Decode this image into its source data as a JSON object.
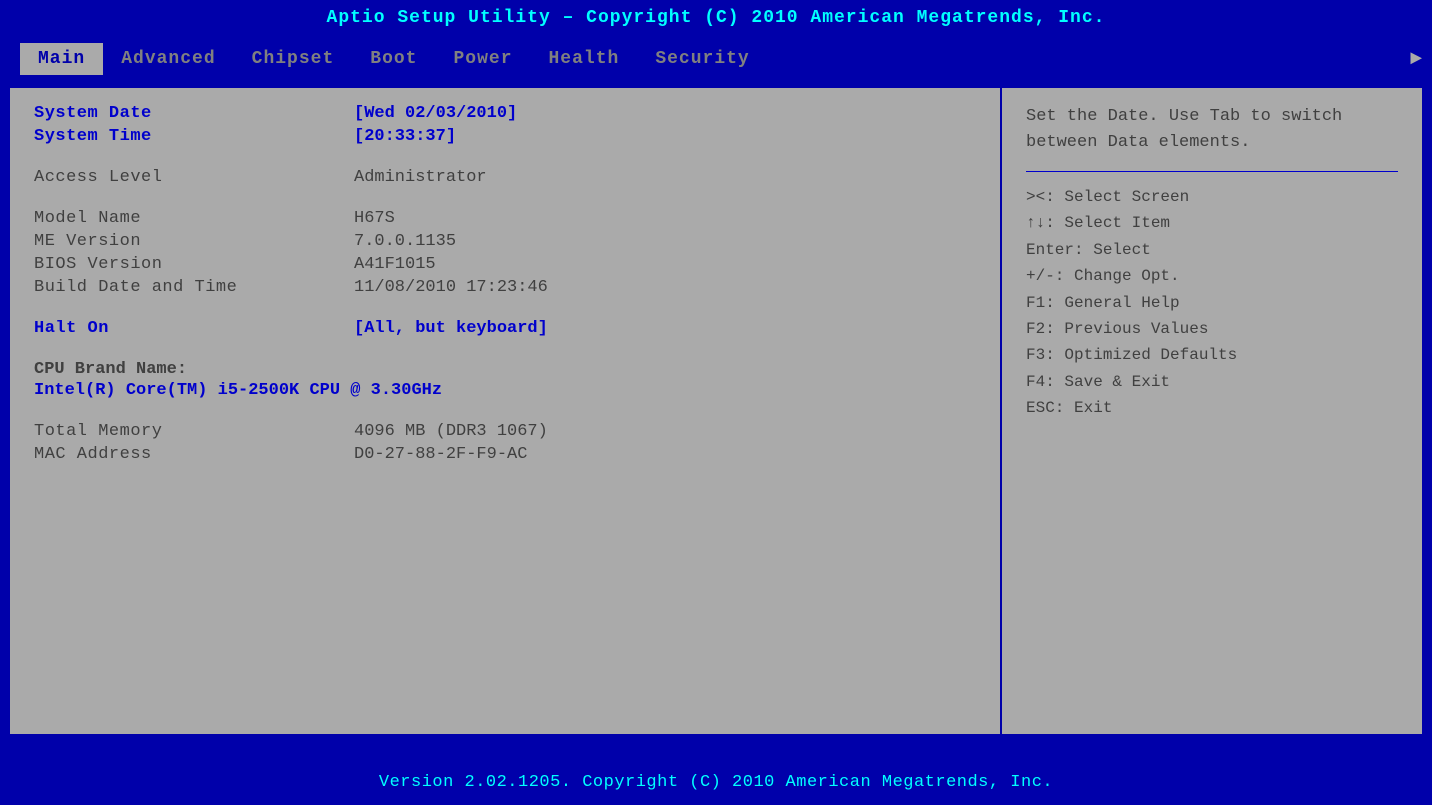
{
  "title": "Aptio Setup Utility – Copyright (C) 2010 American Megatrends, Inc.",
  "footer": "Version 2.02.1205.  Copyright (C) 2010 American Megatrends, Inc.",
  "nav": {
    "tabs": [
      {
        "label": "Main",
        "active": true
      },
      {
        "label": "Advanced",
        "active": false
      },
      {
        "label": "Chipset",
        "active": false
      },
      {
        "label": "Boot",
        "active": false
      },
      {
        "label": "Power",
        "active": false
      },
      {
        "label": "Health",
        "active": false
      },
      {
        "label": "Security",
        "active": false
      }
    ],
    "arrow": "►"
  },
  "fields": {
    "system_date_label": "System Date",
    "system_date_value": "[Wed 02/03/2010]",
    "system_time_label": "System Time",
    "system_time_value": "[20:33:37]",
    "access_level_label": "Access Level",
    "access_level_value": "Administrator",
    "model_name_label": "Model Name",
    "model_name_value": "H67S",
    "me_version_label": "ME Version",
    "me_version_value": "7.0.0.1135",
    "bios_version_label": "BIOS Version",
    "bios_version_value": "A41F1015",
    "build_date_label": "Build Date and Time",
    "build_date_value": "11/08/2010 17:23:46",
    "halt_on_label": "Halt On",
    "halt_on_value": "[All, but keyboard]",
    "cpu_brand_name_label": "CPU Brand Name:",
    "cpu_brand_name_value": "Intel(R) Core(TM) i5-2500K CPU @ 3.30GHz",
    "total_memory_label": "Total Memory",
    "total_memory_value": "4096 MB (DDR3 1067)",
    "mac_address_label": "MAC Address",
    "mac_address_value": "D0-27-88-2F-F9-AC"
  },
  "help": {
    "description": "Set the Date. Use Tab to switch between Data elements.",
    "keys": [
      "><: Select Screen",
      "↑↓: Select Item",
      "Enter: Select",
      "+/-: Change Opt.",
      "F1: General Help",
      "F2: Previous Values",
      "F3: Optimized Defaults",
      "F4: Save & Exit",
      "ESC: Exit"
    ]
  }
}
